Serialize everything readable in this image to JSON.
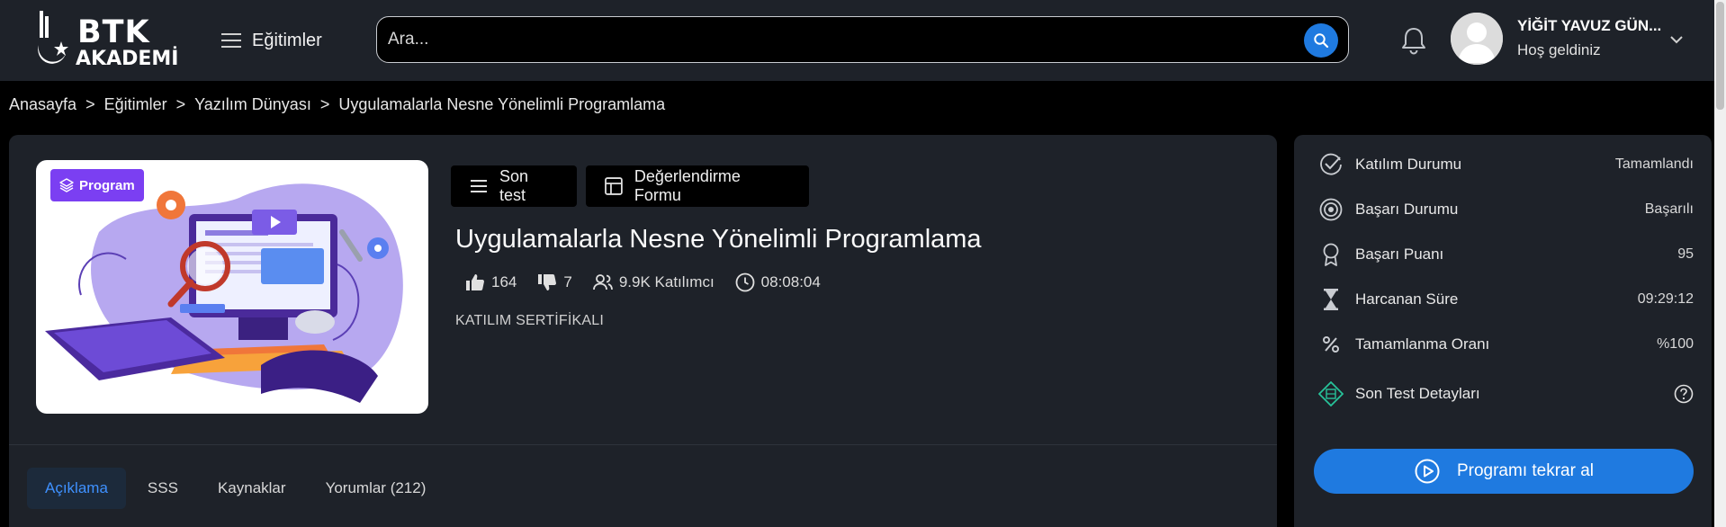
{
  "header": {
    "logo_line1": "BTK",
    "logo_line2": "AKADEMİ",
    "menu_label": "Eğitimler",
    "search_placeholder": "Ara...",
    "user_name": "YİĞİT YAVUZ GÜN...",
    "user_greeting": "Hoş geldiniz"
  },
  "breadcrumb": [
    {
      "label": "Anasayfa"
    },
    {
      "label": "Eğitimler"
    },
    {
      "label": "Yazılım Dünyası"
    },
    {
      "label": "Uygulamalarla Nesne Yönelimli Programlama"
    }
  ],
  "breadcrumb_separator": ">",
  "course": {
    "badge": "Program",
    "son_test_label": "Son test",
    "form_label": "Değerlendirme Formu",
    "title": "Uygulamalarla Nesne Yönelimli Programlama",
    "likes": "164",
    "dislikes": "7",
    "participants": "9.9K Katılımcı",
    "duration": "08:08:04",
    "certificate": "KATILIM SERTİFİKALI"
  },
  "tabs": [
    {
      "label": "Açıklama",
      "active": true
    },
    {
      "label": "SSS",
      "active": false
    },
    {
      "label": "Kaynaklar",
      "active": false
    },
    {
      "label": "Yorumlar (212)",
      "active": false
    }
  ],
  "side": {
    "rows": [
      {
        "label": "Katılım Durumu",
        "value": "Tamamlandı",
        "icon": "check-circle-icon"
      },
      {
        "label": "Başarı Durumu",
        "value": "Başarılı",
        "icon": "target-icon"
      },
      {
        "label": "Başarı Puanı",
        "value": "95",
        "icon": "award-icon"
      },
      {
        "label": "Harcanan Süre",
        "value": "09:29:12",
        "icon": "hourglass-icon"
      },
      {
        "label": "Tamamlanma Oranı",
        "value": "%100",
        "icon": "percent-icon"
      }
    ],
    "test_details_label": "Son Test Detayları",
    "retake_label": "Programı tekrar al"
  },
  "colors": {
    "accent": "#1f7ae0",
    "badge": "#7b3ff2",
    "panel": "#1e2229",
    "active_tab_text": "#3f91ff"
  }
}
